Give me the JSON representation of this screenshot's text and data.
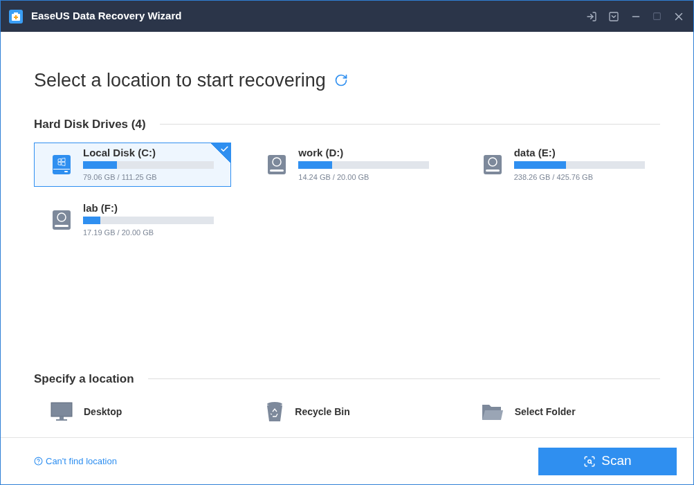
{
  "window": {
    "title": "EaseUS Data Recovery Wizard"
  },
  "heading": "Select a location to start recovering",
  "drives_section": {
    "title": "Hard Disk Drives (4)"
  },
  "drives": [
    {
      "name": "Local Disk (C:)",
      "kind": "system",
      "level": 0.26,
      "usage": "79.06 GB / 111.25 GB",
      "selected": true
    },
    {
      "name": "work (D:)",
      "kind": "disk",
      "level": 0.26,
      "usage": "14.24 GB / 20.00 GB",
      "selected": false
    },
    {
      "name": "data (E:)",
      "kind": "disk",
      "level": 0.4,
      "usage": "238.26 GB / 425.76 GB",
      "selected": false
    },
    {
      "name": "lab (F:)",
      "kind": "disk",
      "level": 0.13,
      "usage": "17.19 GB / 20.00 GB",
      "selected": false
    }
  ],
  "locations_section": {
    "title": "Specify a location"
  },
  "locations": [
    {
      "name": "Desktop",
      "kind": "desktop"
    },
    {
      "name": "Recycle Bin",
      "kind": "recycle"
    },
    {
      "name": "Select Folder",
      "kind": "folder"
    }
  ],
  "help_link": "Can't find location",
  "scan_button": "Scan"
}
